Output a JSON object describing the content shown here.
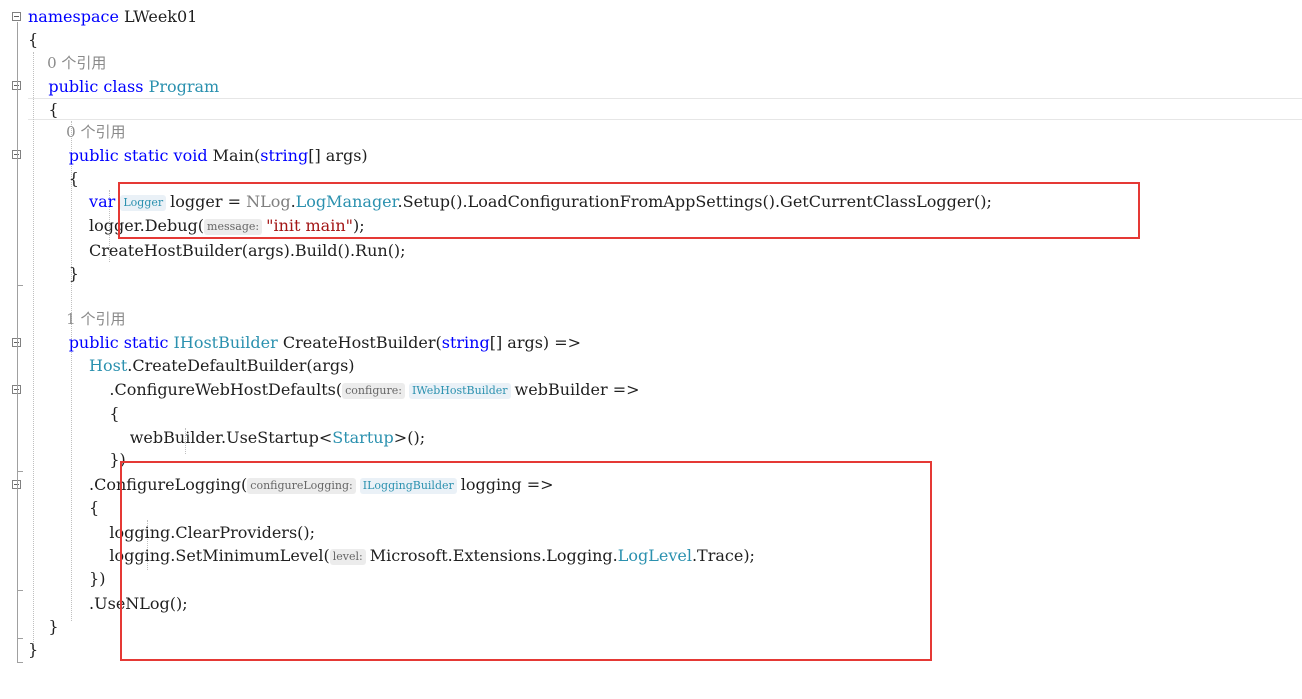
{
  "editor": {
    "lines": [
      {
        "id": "l1",
        "tokens": [
          {
            "t": "namespace",
            "c": "kw"
          },
          {
            "t": " LWeek01",
            "c": "nm"
          }
        ]
      },
      {
        "id": "l2",
        "tokens": [
          {
            "t": "{",
            "c": "nm"
          }
        ]
      },
      {
        "id": "l3",
        "codelens": true,
        "tokens": [
          {
            "t": "    0 个引用",
            "c": "gray"
          }
        ]
      },
      {
        "id": "l4",
        "tokens": [
          {
            "t": "    ",
            "c": "nm"
          },
          {
            "t": "public",
            "c": "kw"
          },
          {
            "t": " ",
            "c": "nm"
          },
          {
            "t": "class",
            "c": "kw"
          },
          {
            "t": " ",
            "c": "nm"
          },
          {
            "t": "Program",
            "c": "ty"
          }
        ]
      },
      {
        "id": "l5",
        "tokens": [
          {
            "t": "    {",
            "c": "nm"
          }
        ]
      },
      {
        "id": "l6",
        "codelens": true,
        "tokens": [
          {
            "t": "        0 个引用",
            "c": "gray"
          }
        ]
      },
      {
        "id": "l7",
        "tokens": [
          {
            "t": "        ",
            "c": "nm"
          },
          {
            "t": "public",
            "c": "kw"
          },
          {
            "t": " ",
            "c": "nm"
          },
          {
            "t": "static",
            "c": "kw"
          },
          {
            "t": " ",
            "c": "nm"
          },
          {
            "t": "void",
            "c": "kw"
          },
          {
            "t": " Main(",
            "c": "nm"
          },
          {
            "t": "string",
            "c": "kw"
          },
          {
            "t": "[] args)",
            "c": "nm"
          }
        ]
      },
      {
        "id": "l8",
        "tokens": [
          {
            "t": "        {",
            "c": "nm"
          }
        ]
      },
      {
        "id": "l9",
        "tokens": [
          {
            "t": "            ",
            "c": "nm"
          },
          {
            "t": "var",
            "c": "kw"
          },
          {
            "t": " ",
            "c": "nm"
          },
          {
            "t": "Logger",
            "c": "tyhint"
          },
          {
            "t": "logger = ",
            "c": "nm"
          },
          {
            "t": "NLog",
            "c": "ns"
          },
          {
            "t": ".",
            "c": "nm"
          },
          {
            "t": "LogManager",
            "c": "ty"
          },
          {
            "t": ".Setup().LoadConfigurationFromAppSettings().GetCurrentClassLogger();",
            "c": "nm"
          }
        ]
      },
      {
        "id": "l10",
        "tokens": [
          {
            "t": "            logger.Debug(",
            "c": "nm"
          },
          {
            "t": "message:",
            "c": "hint"
          },
          {
            "t": "\"init main\"",
            "c": "str"
          },
          {
            "t": ");",
            "c": "nm"
          }
        ]
      },
      {
        "id": "l11",
        "tokens": [
          {
            "t": "            CreateHostBuilder(args).Build().Run();",
            "c": "nm"
          }
        ]
      },
      {
        "id": "l12",
        "tokens": [
          {
            "t": "        }",
            "c": "nm"
          }
        ]
      },
      {
        "id": "l13",
        "tokens": []
      },
      {
        "id": "l14",
        "codelens": true,
        "tokens": [
          {
            "t": "        1 个引用",
            "c": "gray"
          }
        ]
      },
      {
        "id": "l15",
        "tokens": [
          {
            "t": "        ",
            "c": "nm"
          },
          {
            "t": "public",
            "c": "kw"
          },
          {
            "t": " ",
            "c": "nm"
          },
          {
            "t": "static",
            "c": "kw"
          },
          {
            "t": " ",
            "c": "nm"
          },
          {
            "t": "IHostBuilder",
            "c": "ty"
          },
          {
            "t": " CreateHostBuilder(",
            "c": "nm"
          },
          {
            "t": "string",
            "c": "kw"
          },
          {
            "t": "[] args) =>",
            "c": "nm"
          }
        ]
      },
      {
        "id": "l16",
        "tokens": [
          {
            "t": "            ",
            "c": "nm"
          },
          {
            "t": "Host",
            "c": "ty"
          },
          {
            "t": ".CreateDefaultBuilder(args)",
            "c": "nm"
          }
        ]
      },
      {
        "id": "l17",
        "tokens": [
          {
            "t": "                .ConfigureWebHostDefaults(",
            "c": "nm"
          },
          {
            "t": "configure:",
            "c": "hint"
          },
          {
            "t": "IWebHostBuilder",
            "c": "tyhint"
          },
          {
            "t": "webBuilder =>",
            "c": "nm"
          }
        ]
      },
      {
        "id": "l18",
        "tokens": [
          {
            "t": "                {",
            "c": "nm"
          }
        ]
      },
      {
        "id": "l19",
        "tokens": [
          {
            "t": "                    webBuilder.UseStartup<",
            "c": "nm"
          },
          {
            "t": "Startup",
            "c": "ty"
          },
          {
            "t": ">();",
            "c": "nm"
          }
        ]
      },
      {
        "id": "l20",
        "tokens": [
          {
            "t": "                })",
            "c": "nm"
          }
        ]
      },
      {
        "id": "l21",
        "tokens": [
          {
            "t": "            .ConfigureLogging(",
            "c": "nm"
          },
          {
            "t": "configureLogging:",
            "c": "hint"
          },
          {
            "t": "ILoggingBuilder",
            "c": "tyhint"
          },
          {
            "t": "logging =>",
            "c": "nm"
          }
        ]
      },
      {
        "id": "l22",
        "tokens": [
          {
            "t": "            {",
            "c": "nm"
          }
        ]
      },
      {
        "id": "l23",
        "tokens": [
          {
            "t": "                logging.ClearProviders();",
            "c": "nm"
          }
        ]
      },
      {
        "id": "l24",
        "tokens": [
          {
            "t": "                logging.SetMinimumLevel(",
            "c": "nm"
          },
          {
            "t": "level:",
            "c": "hint"
          },
          {
            "t": "Microsoft.Extensions.Logging.",
            "c": "nm"
          },
          {
            "t": "LogLevel",
            "c": "ty"
          },
          {
            "t": ".Trace);",
            "c": "nm"
          }
        ]
      },
      {
        "id": "l25",
        "tokens": [
          {
            "t": "            })",
            "c": "nm"
          }
        ]
      },
      {
        "id": "l26",
        "tokens": [
          {
            "t": "            .UseNLog();",
            "c": "nm"
          }
        ]
      },
      {
        "id": "l27",
        "tokens": [
          {
            "t": "    }",
            "c": "nm"
          }
        ]
      },
      {
        "id": "l28",
        "tokens": [
          {
            "t": "}",
            "c": "nm"
          }
        ]
      }
    ]
  },
  "colors": {
    "keyword": "#0000ff",
    "type": "#2b91af",
    "string": "#a31515",
    "text": "#1f1f1f",
    "codelens": "#8a8a8a",
    "highlight_box": "#e53935"
  }
}
